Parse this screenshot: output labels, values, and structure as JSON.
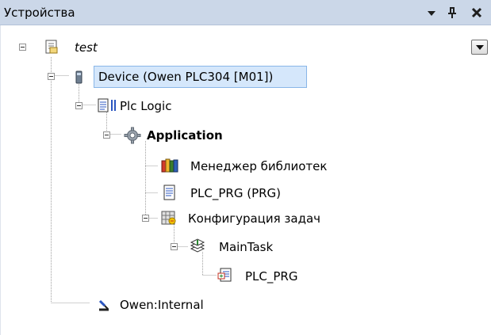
{
  "panel": {
    "title": "Устройства",
    "buttons": {
      "dropdown": "chevron-down-icon",
      "pin": "pin-icon",
      "close": "close-icon"
    }
  },
  "tree": {
    "nodes": [
      {
        "id": "test",
        "label": "test",
        "icon": "project-icon",
        "expanded": true
      },
      {
        "id": "device",
        "label": "Device (Owen PLC304 [M01])",
        "icon": "device-icon",
        "expanded": true,
        "selected": true
      },
      {
        "id": "plc-logic",
        "label": "Plc Logic",
        "icon": "plc-logic-icon",
        "expanded": true
      },
      {
        "id": "application",
        "label": "Application",
        "icon": "gear-icon",
        "expanded": true
      },
      {
        "id": "library-manager",
        "label": "Менеджер библиотек",
        "icon": "library-books-icon"
      },
      {
        "id": "plc-prg",
        "label": "PLC_PRG (PRG)",
        "icon": "document-icon"
      },
      {
        "id": "task-config",
        "label": "Конфигурация задач",
        "icon": "task-config-icon",
        "expanded": true
      },
      {
        "id": "main-task",
        "label": "MainTask",
        "icon": "task-stack-icon",
        "expanded": true
      },
      {
        "id": "plc-prg-call",
        "label": "PLC_PRG",
        "icon": "pou-call-icon"
      },
      {
        "id": "owen-internal",
        "label": "Owen:Internal",
        "icon": "io-connector-icon"
      }
    ]
  },
  "colors": {
    "titlebar": "#cbd7e8",
    "selection_fill": "#d5e7fb",
    "selection_border": "#89b6e8",
    "tree_lines": "#a0a0a0"
  }
}
